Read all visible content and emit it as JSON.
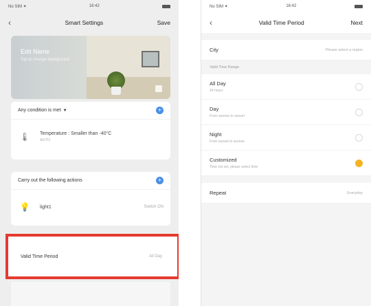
{
  "left_screen": {
    "status": {
      "time": "16:42",
      "carrier": "No SIM ✦"
    },
    "nav": {
      "back": "‹",
      "title": "Smart Settings",
      "action": "Save"
    },
    "scene": {
      "name": "Edit Name",
      "sub": "Tap to change background"
    },
    "conditions": {
      "header": "Any condition is met",
      "items": [
        {
          "main": "Temperature : Smaller than -40°C",
          "sub": "AUTO"
        }
      ]
    },
    "actions": {
      "header": "Carry out the following actions",
      "items": [
        {
          "main": "light1",
          "right": "Switch ON"
        }
      ]
    },
    "valid_time": {
      "label": "Valid Time Period",
      "value": "All Day"
    }
  },
  "right_screen": {
    "status": {
      "time": "16:42",
      "carrier": "No SIM ✦"
    },
    "nav": {
      "back": "‹",
      "title": "Valid Time Period",
      "action": "Next"
    },
    "city": {
      "label": "City",
      "value": "Please select a region"
    },
    "section_label": "Valid Time Range",
    "options": [
      {
        "label": "All Day",
        "sub": "24 hours",
        "selected": false
      },
      {
        "label": "Day",
        "sub": "From sunrise to sunset",
        "selected": false
      },
      {
        "label": "Night",
        "sub": "From sunset to sunrise",
        "selected": false
      },
      {
        "label": "Customized",
        "sub": "Time not set, please select time",
        "selected": true
      }
    ],
    "repeat": {
      "label": "Repeat",
      "value": "Everyday"
    }
  },
  "colors": {
    "highlight": "#e53a30",
    "accent_blue": "#4a8fe7",
    "selected_radio": "#f4b322"
  }
}
